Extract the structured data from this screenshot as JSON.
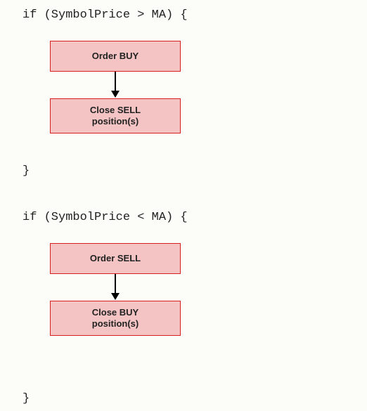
{
  "block1": {
    "condition_line": "if (SymbolPrice > MA) {",
    "close_brace": "}",
    "box1": "Order BUY",
    "box2_line1": "Close SELL",
    "box2_line2": "position(s)"
  },
  "block2": {
    "condition_line": "if (SymbolPrice < MA) {",
    "close_brace": "}",
    "box1": "Order SELL",
    "box2_line1": "Close BUY",
    "box2_line2": "position(s)"
  }
}
